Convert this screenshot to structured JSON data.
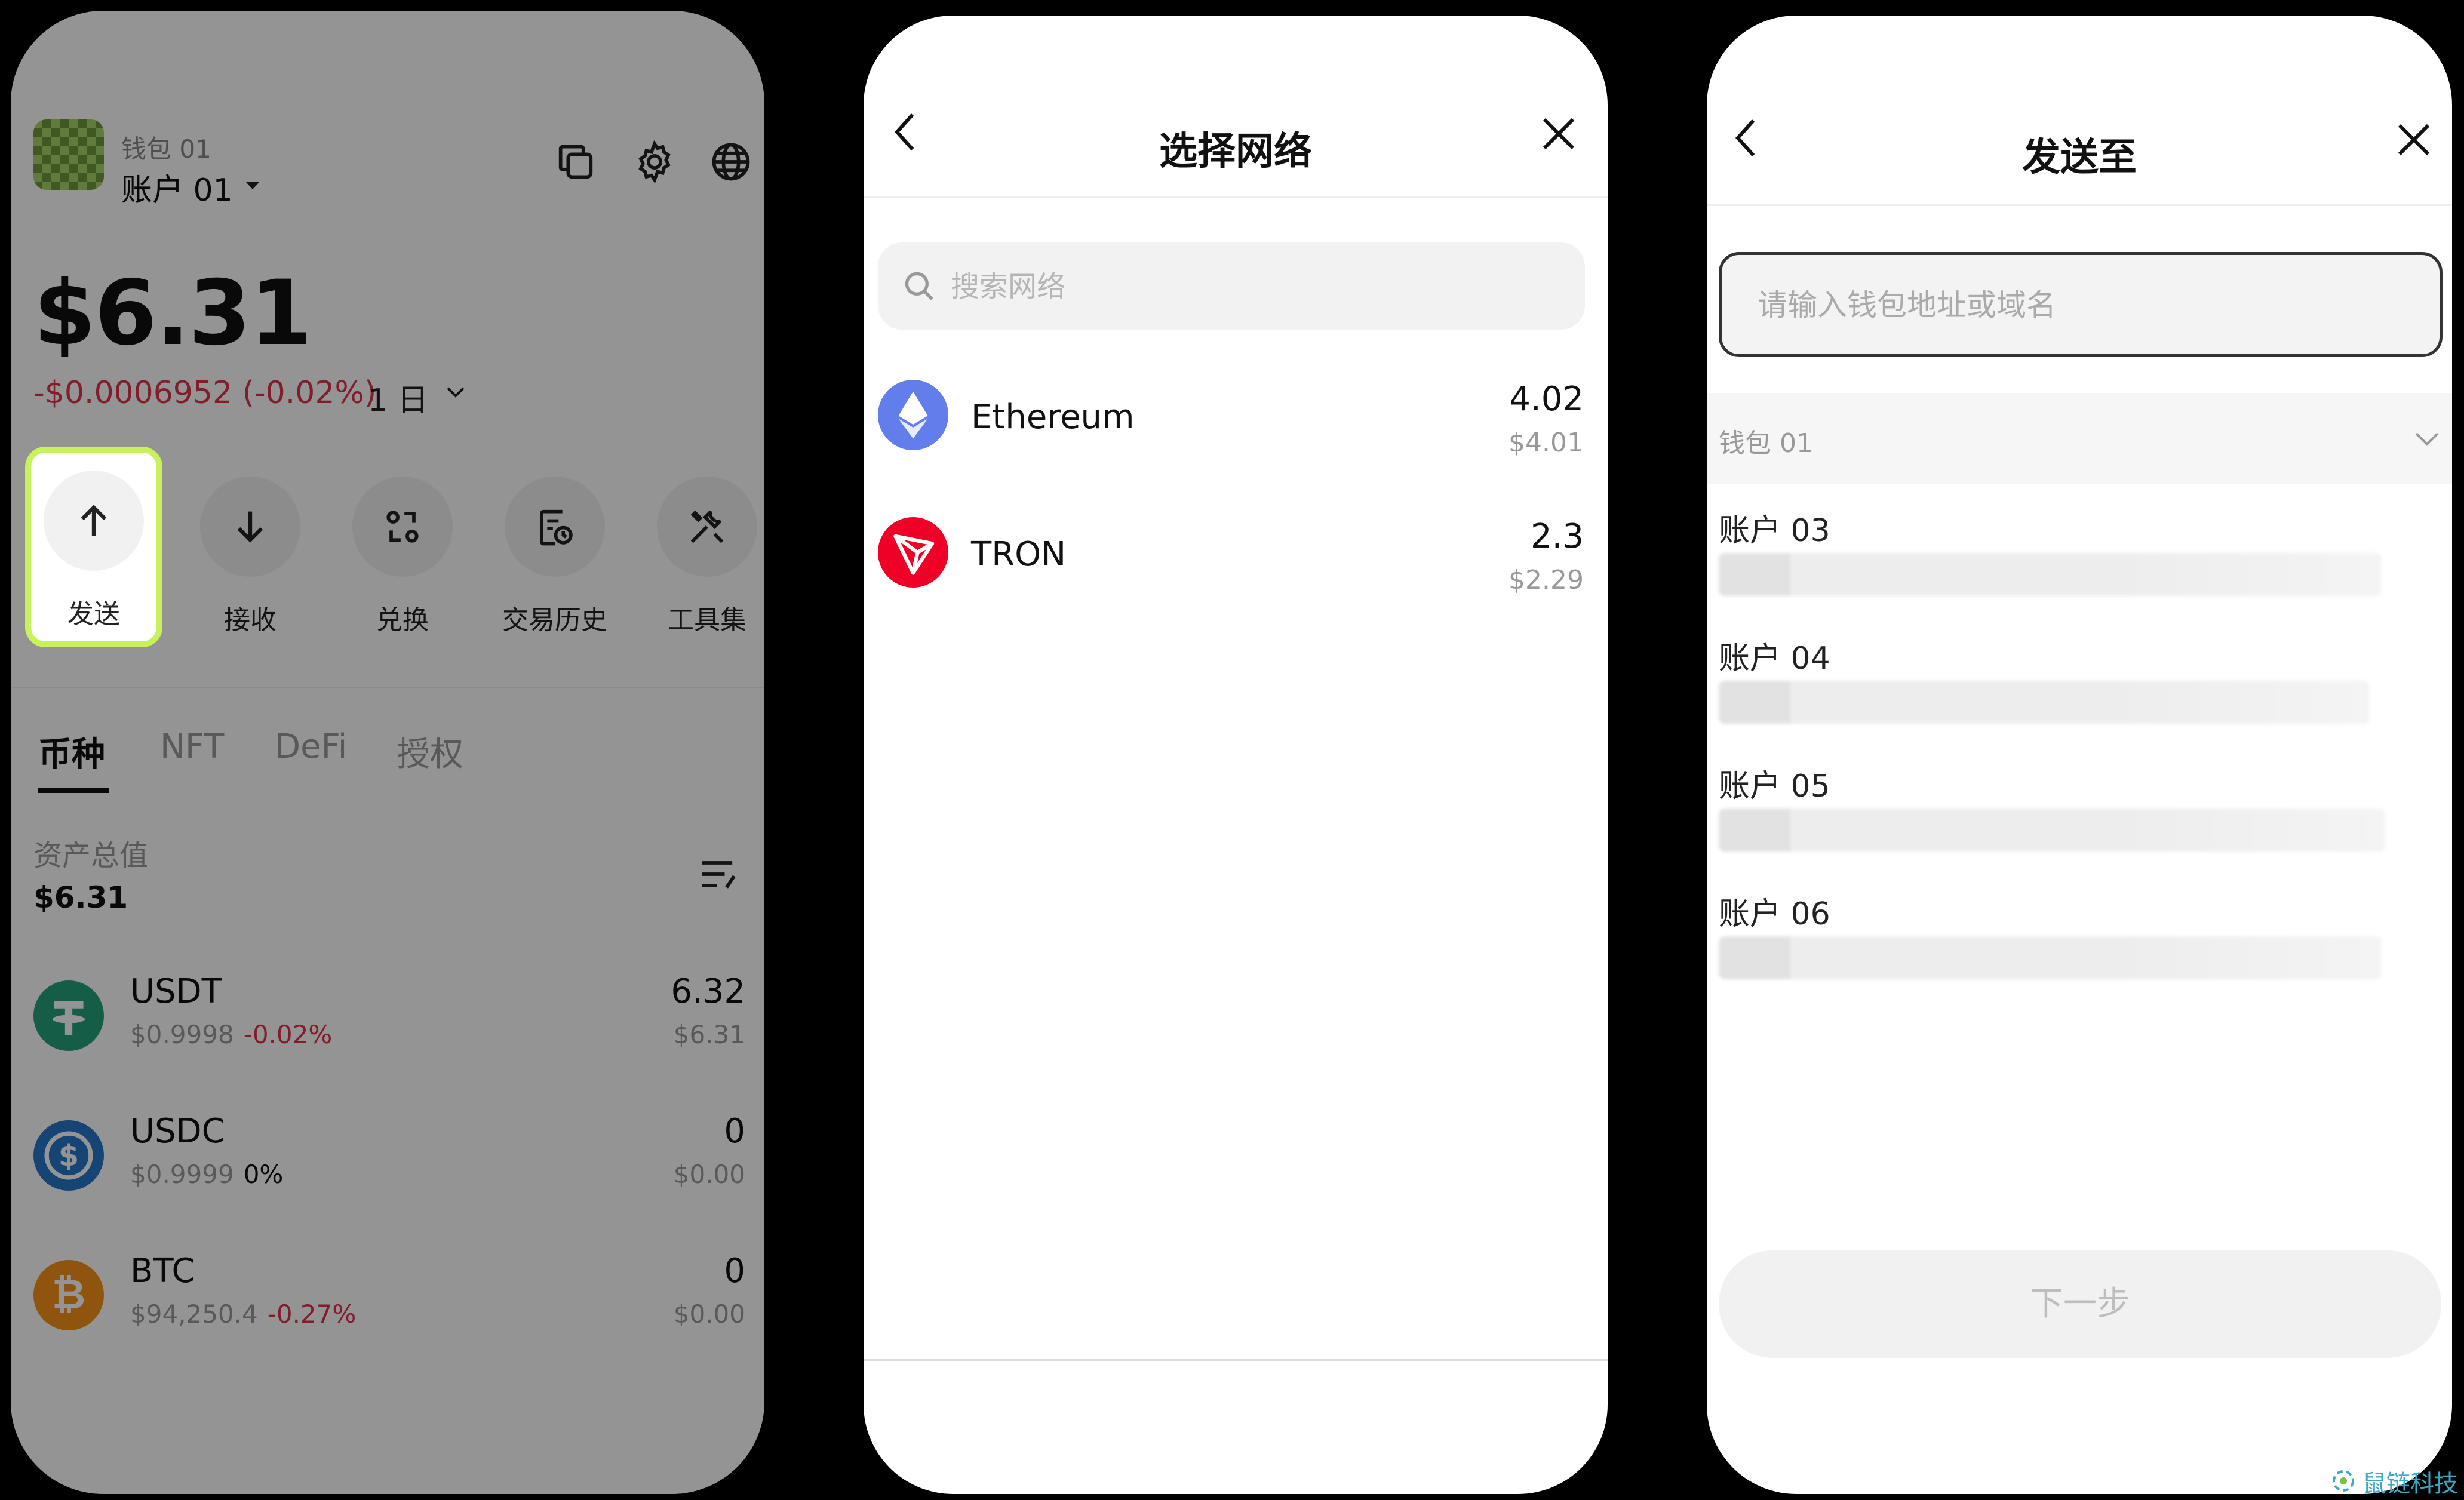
{
  "screen_wallet": {
    "wallet_name": "钱包 01",
    "account_name": "账户 01",
    "header_icons": [
      "copy-icon",
      "gear-icon",
      "globe-icon"
    ],
    "balance": "$6.31",
    "change": "-$0.0006952 (-0.02%)",
    "period": "1 日",
    "actions": [
      {
        "label": "发送",
        "icon": "arrow-up-icon",
        "highlighted": true
      },
      {
        "label": "接收",
        "icon": "arrow-down-icon"
      },
      {
        "label": "兑换",
        "icon": "swap-icon"
      },
      {
        "label": "交易历史",
        "icon": "history-icon"
      },
      {
        "label": "工具集",
        "icon": "tools-icon"
      }
    ],
    "tabs": [
      "币种",
      "NFT",
      "DeFi",
      "授权"
    ],
    "active_tab": "币种",
    "total_label": "资产总值",
    "total_value": "$6.31",
    "tokens": [
      {
        "symbol": "USDT",
        "price": "$0.9998",
        "change": "-0.02%",
        "amount": "6.32",
        "usd": "$6.31",
        "icon": "tether-icon",
        "color": "#26a17b"
      },
      {
        "symbol": "USDC",
        "price": "$0.9999",
        "change": "0%",
        "amount": "0",
        "usd": "$0.00",
        "icon": "usdc-icon",
        "color": "#2775ca"
      },
      {
        "symbol": "BTC",
        "price": "$94,250.4",
        "change": "-0.27%",
        "amount": "0",
        "usd": "$0.00",
        "icon": "bitcoin-icon",
        "color": "#f7931a"
      }
    ],
    "colors": {
      "highlight": "#c7f25c",
      "negative": "#e0334a"
    }
  },
  "screen_network": {
    "title": "选择网络",
    "search_placeholder": "搜索网络",
    "networks": [
      {
        "name": "Ethereum",
        "amount": "4.02",
        "usd": "$4.01",
        "icon": "ethereum-icon",
        "color": "#627eea"
      },
      {
        "name": "TRON",
        "amount": "2.3",
        "usd": "$2.29",
        "icon": "tron-icon",
        "color": "#ef0027"
      }
    ]
  },
  "screen_send": {
    "title": "发送至",
    "address_placeholder": "请输入钱包地址或域名",
    "group_name": "钱包 01",
    "accounts": [
      "账户 03",
      "账户 04",
      "账户 05",
      "账户 06"
    ],
    "next_label": "下一步"
  },
  "watermark": {
    "text": "鼠链科技"
  }
}
